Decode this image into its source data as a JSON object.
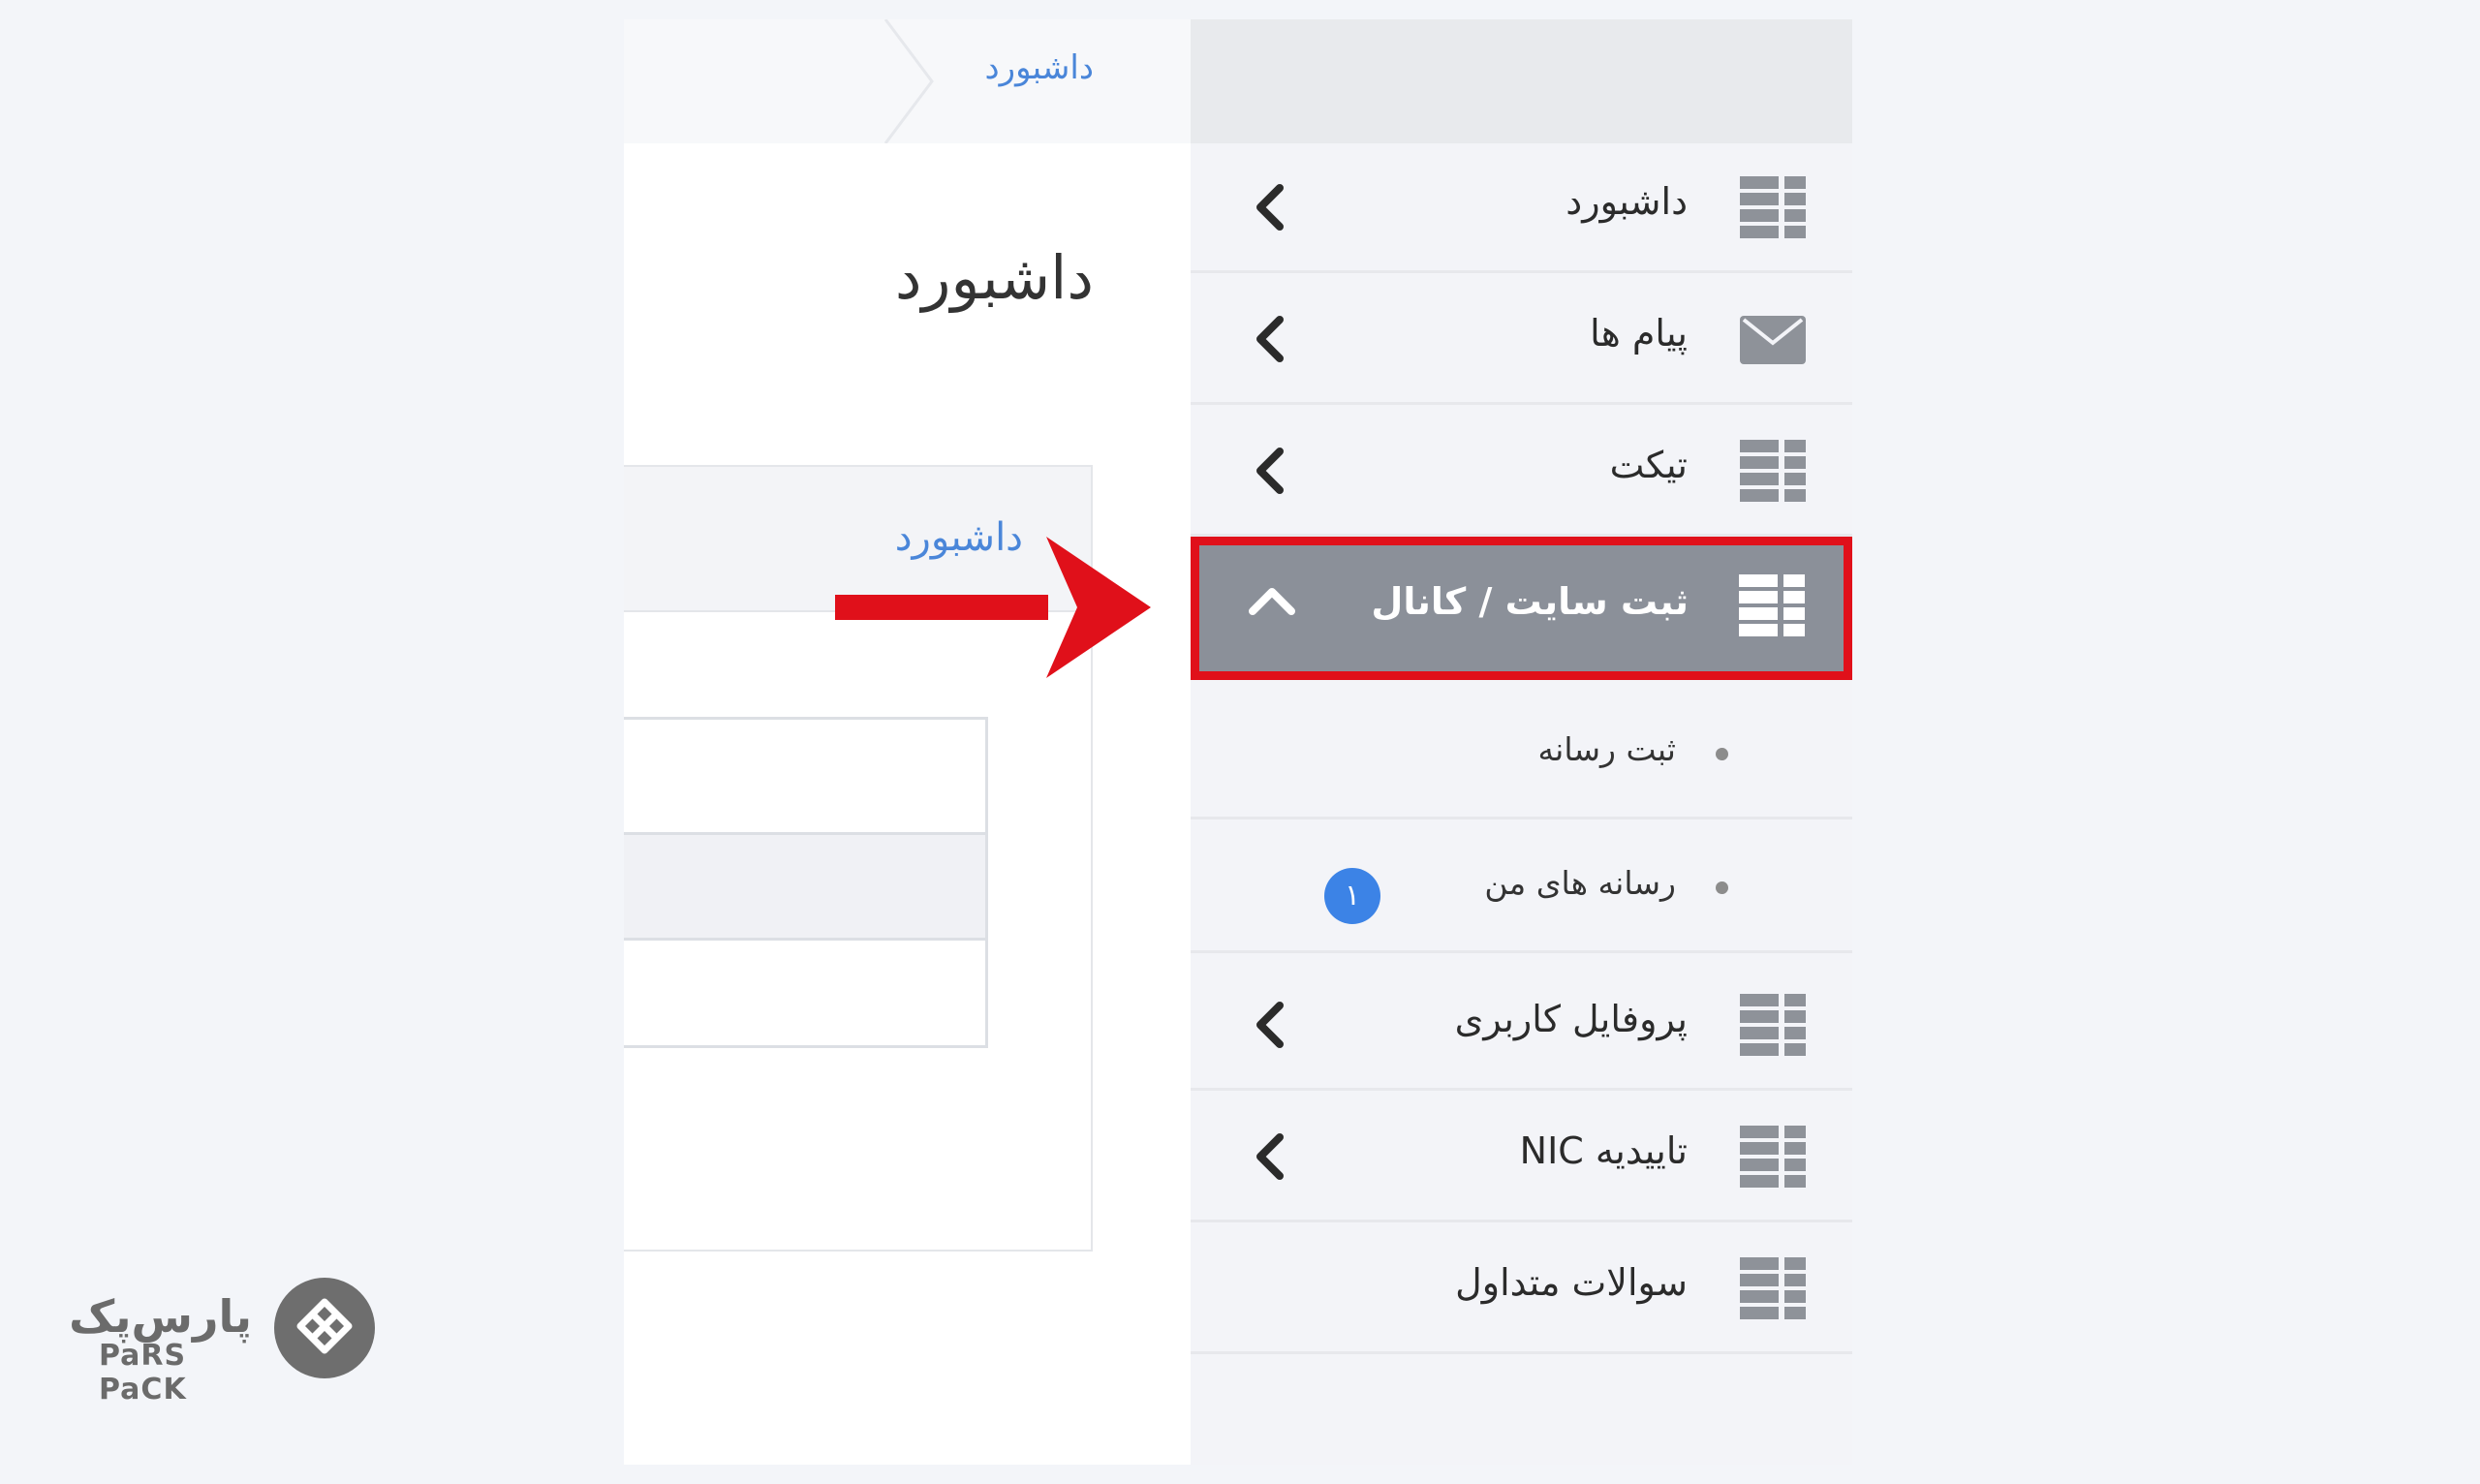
{
  "breadcrumb": {
    "label": "داشبورد"
  },
  "page": {
    "title": "داشبورد"
  },
  "panel": {
    "header_link": "داشبورد"
  },
  "sidebar": {
    "items": [
      {
        "label": "داشبورد",
        "icon": "grid-icon"
      },
      {
        "label": "پیام ها",
        "icon": "envelope-icon"
      },
      {
        "label": "تیکت",
        "icon": "grid-icon"
      },
      {
        "label": "ثبت سایت / کانال",
        "icon": "grid-icon",
        "expanded": true
      },
      {
        "label": "پروفایل کاربری",
        "icon": "grid-icon"
      },
      {
        "label": "تاییدیه NIC",
        "icon": "grid-icon"
      },
      {
        "label": "سوالات متداول",
        "icon": "grid-icon"
      }
    ],
    "subitems": [
      {
        "label": "ثبت رسانه"
      },
      {
        "label": "رسانه های من",
        "badge": "۱"
      }
    ]
  },
  "logo": {
    "fa": "پارس‌پک",
    "en": "PaRS PaCK"
  },
  "colors": {
    "highlight_border": "#e0101a",
    "active_bg": "#8b9099",
    "link": "#4a86d9",
    "badge": "#3c83e6"
  }
}
